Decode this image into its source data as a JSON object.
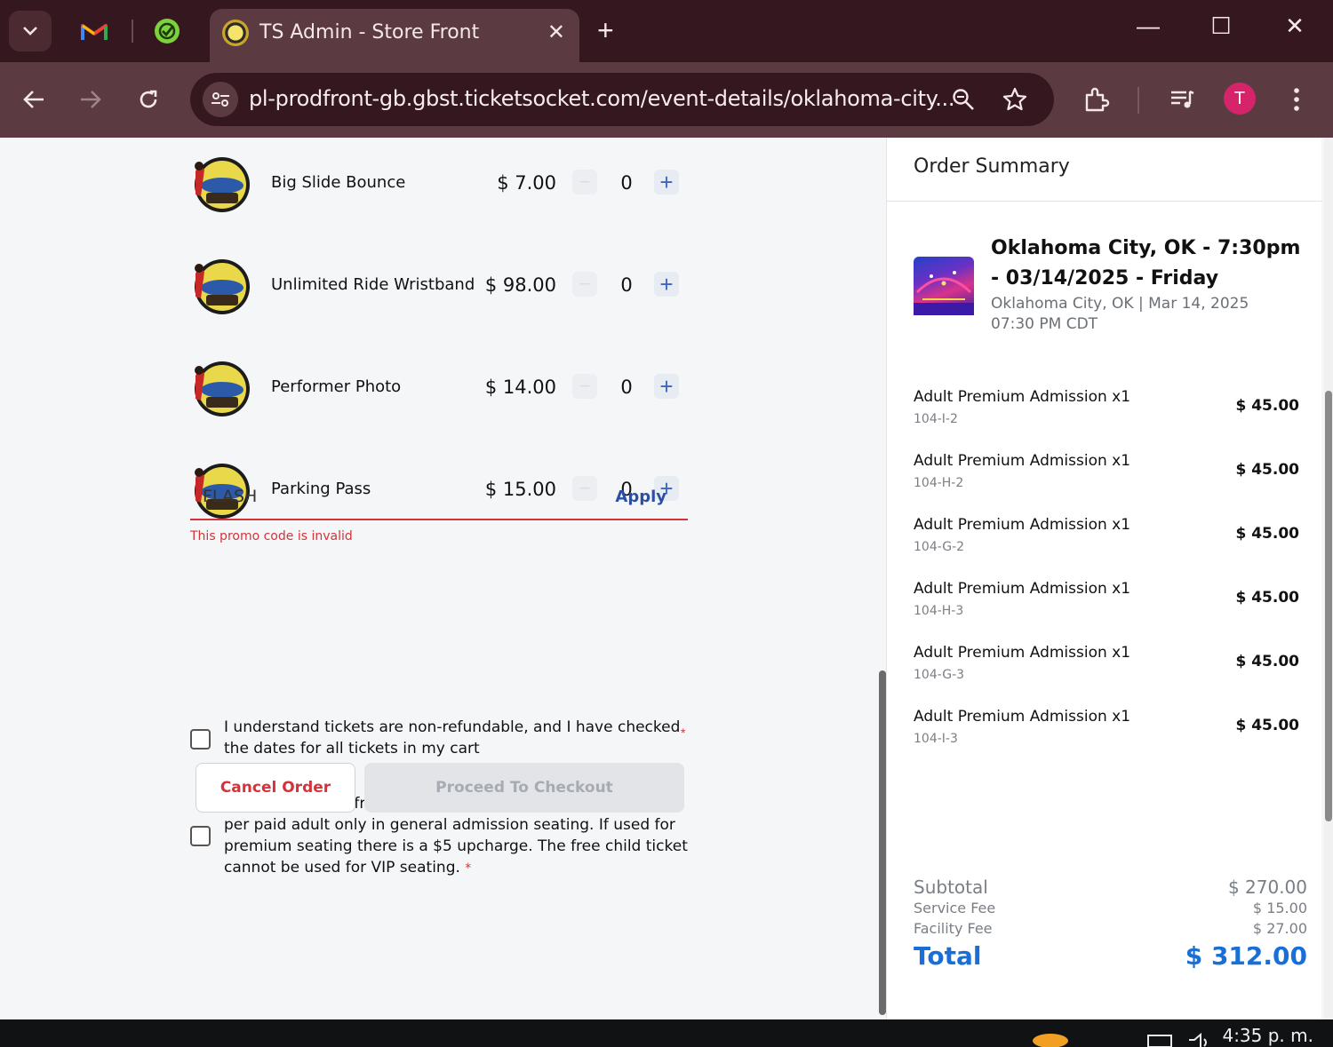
{
  "browser": {
    "tab_title": "TS Admin - Store Front",
    "url": "pl-prodfront-gb.gbst.ticketsocket.com/event-details/oklahoma-city...",
    "profile_initial": "T"
  },
  "addons": [
    {
      "name": "Big Slide Bounce",
      "price": "$ 7.00",
      "qty": "0"
    },
    {
      "name": "Unlimited Ride Wristband",
      "price": "$ 98.00",
      "qty": "0"
    },
    {
      "name": "Performer Photo",
      "price": "$ 14.00",
      "qty": "0"
    },
    {
      "name": "Parking Pass",
      "price": "$ 15.00",
      "qty": "0"
    }
  ],
  "promo": {
    "value": "FLASH",
    "apply_label": "Apply",
    "error": "This promo code is invalid"
  },
  "consents": [
    {
      "text": "I understand tickets are non-refundable, and I have checked the dates for all tickets in my cart",
      "required_mark": "*"
    },
    {
      "text": "I understand the free child ticket is valid for one free child per paid adult only in general admission seating. If used for premium seating there is a $5 upcharge. The free child ticket cannot be used for VIP seating.",
      "required_mark": "*"
    }
  ],
  "buttons": {
    "cancel": "Cancel Order",
    "proceed": "Proceed To Checkout"
  },
  "summary": {
    "title": "Order Summary",
    "event_name": "Oklahoma City, OK - 7:30pm - 03/14/2025 - Friday",
    "event_location_date": "Oklahoma City, OK | Mar 14, 2025",
    "event_time": "07:30 PM CDT",
    "items": [
      {
        "name": "Adult Premium Admission x1",
        "seat": "104-I-2",
        "price": "$ 45.00"
      },
      {
        "name": "Adult Premium Admission x1",
        "seat": "104-H-2",
        "price": "$ 45.00"
      },
      {
        "name": "Adult Premium Admission x1",
        "seat": "104-G-2",
        "price": "$ 45.00"
      },
      {
        "name": "Adult Premium Admission x1",
        "seat": "104-H-3",
        "price": "$ 45.00"
      },
      {
        "name": "Adult Premium Admission x1",
        "seat": "104-G-3",
        "price": "$ 45.00"
      },
      {
        "name": "Adult Premium Admission x1",
        "seat": "104-I-3",
        "price": "$ 45.00"
      }
    ],
    "subtotal_label": "Subtotal",
    "subtotal": "$ 270.00",
    "service_fee_label": "Service Fee",
    "service_fee": "$ 15.00",
    "facility_fee_label": "Facility Fee",
    "facility_fee": "$ 27.00",
    "total_label": "Total",
    "total": "$ 312.00"
  },
  "taskbar": {
    "clock": "4:35 p. m."
  },
  "colors": {
    "tab_bar": "#35181f",
    "toolbar": "#5c3a42",
    "error_red": "#d6323a",
    "total_blue": "#1a6fd6",
    "apply_blue": "#2d4fa3"
  }
}
